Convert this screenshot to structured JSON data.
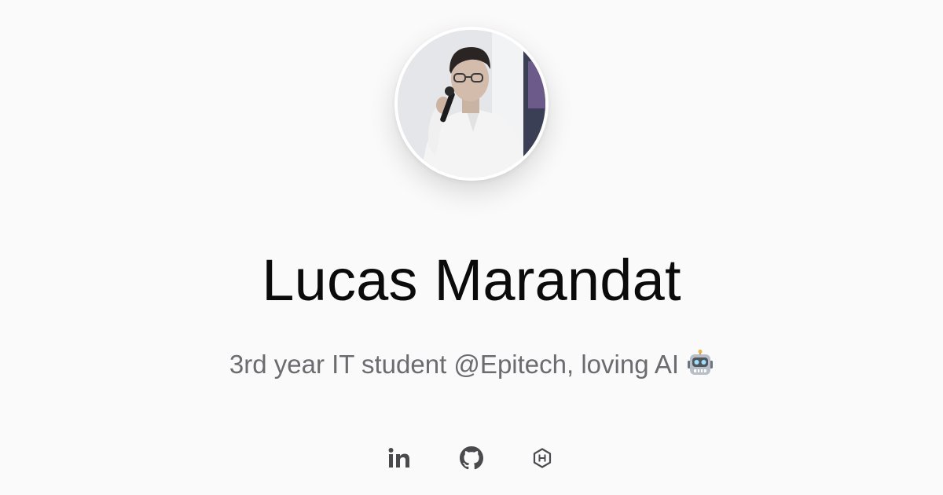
{
  "profile": {
    "name": "Lucas Marandat",
    "bio": "3rd year IT student @Epitech, loving AI",
    "bio_emoji": "robot-face-emoji",
    "avatar_description": "profile-photo"
  },
  "socials": [
    {
      "icon": "linkedin-icon"
    },
    {
      "icon": "github-icon"
    },
    {
      "icon": "hashnode-icon"
    }
  ],
  "colors": {
    "background": "#fafafa",
    "name_text": "#0b0b0b",
    "bio_text": "#6b6b70",
    "icon": "#4a4a4e"
  }
}
